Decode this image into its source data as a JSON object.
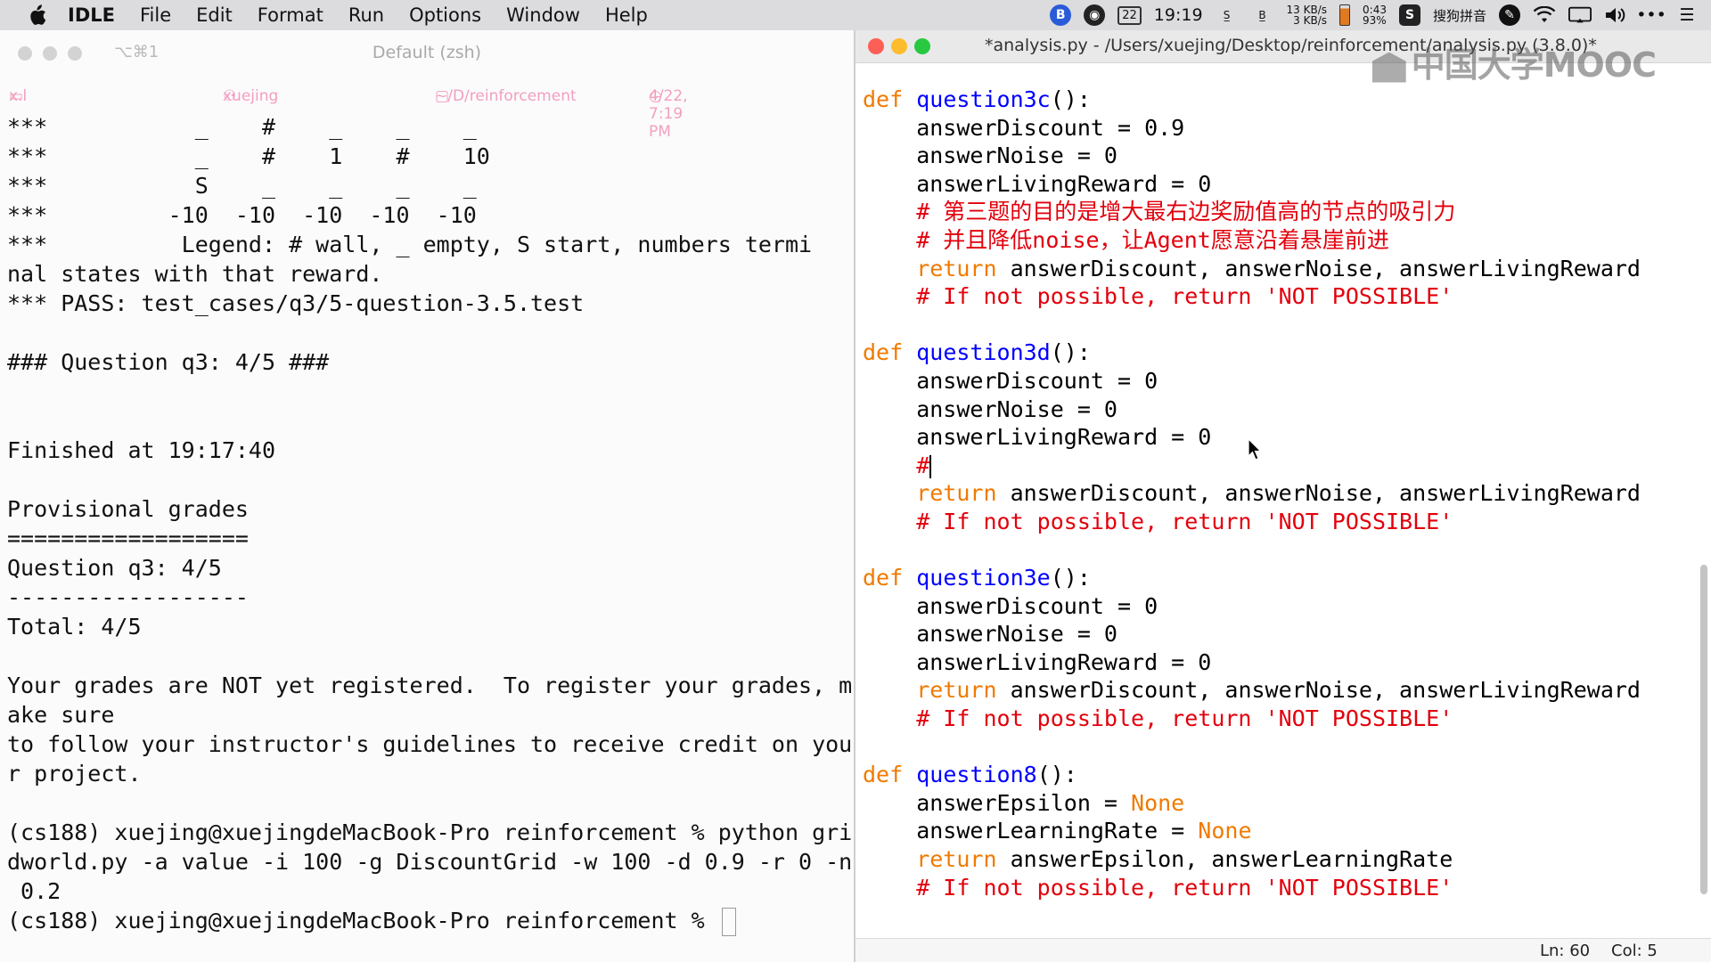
{
  "menubar": {
    "items": [
      "IDLE",
      "File",
      "Edit",
      "Format",
      "Run",
      "Options",
      "Window",
      "Help"
    ],
    "clock": "19:19",
    "calendar_day": "22",
    "net_up": "13 KB/s",
    "net_down": "3 KB/s",
    "battery_time": "0:43",
    "battery_pct": "93%",
    "input_method": "搜狗拼音",
    "icons": [
      "apple-icon",
      "bluetooth-icon",
      "chrome-icon",
      "calendar-icon",
      "s-icon",
      "b-icon",
      "battery-icon",
      "sogou-icon",
      "app-icon",
      "wifi-icon",
      "display-icon",
      "volume-icon",
      "more-icon",
      "list-icon"
    ]
  },
  "terminal": {
    "title": "Default (zsh)",
    "shortcut": "⌥⌘1",
    "tab_label": "x.l",
    "user": "xuejing",
    "folder": "~/D/reinforcement",
    "datetime": "4/22, 7:19 PM",
    "lines": [
      "***           _    #    _    _    _",
      "***           _    #    1    #    10",
      "***           S    _    _    _    _",
      "***         -10  -10  -10  -10  -10",
      "***          Legend: # wall, _ empty, S start, numbers termi",
      "nal states with that reward.",
      "*** PASS: test_cases/q3/5-question-3.5.test",
      "",
      "### Question q3: 4/5 ###",
      "",
      "",
      "Finished at 19:17:40",
      "",
      "Provisional grades",
      "==================",
      "Question q3: 4/5",
      "------------------",
      "Total: 4/5",
      "",
      "Your grades are NOT yet registered.  To register your grades, m",
      "ake sure",
      "to follow your instructor's guidelines to receive credit on you",
      "r project.",
      "",
      "(cs188) xuejing@xuejingdeMacBook-Pro reinforcement % python gri",
      "dworld.py -a value -i 100 -g DiscountGrid -w 100 -d 0.9 -r 0 -n",
      " 0.2",
      "(cs188) xuejing@xuejingdeMacBook-Pro reinforcement % "
    ]
  },
  "editor": {
    "title": "*analysis.py - /Users/xuejing/Desktop/reinforcement/analysis.py (3.8.0)*",
    "watermark": "中国大学MOOC",
    "status_line": "Ln: 60",
    "status_col": "Col: 5",
    "code": [
      [
        [
          "kw",
          "def "
        ],
        [
          "fn",
          "question3c"
        ],
        [
          "",
          "():"
        ]
      ],
      [
        [
          "",
          "    answerDiscount = 0.9"
        ]
      ],
      [
        [
          "",
          "    answerNoise = 0"
        ]
      ],
      [
        [
          "",
          "    answerLivingReward = 0"
        ]
      ],
      [
        [
          "cm",
          "    # 第三题的目的是增大最右边奖励值高的节点的吸引力"
        ]
      ],
      [
        [
          "cm",
          "    # 并且降低noise，让Agent愿意沿着悬崖前进"
        ]
      ],
      [
        [
          "kw",
          "    return"
        ],
        [
          "",
          " answerDiscount, answerNoise, answerLivingReward"
        ]
      ],
      [
        [
          "cm",
          "    # If not possible, return 'NOT POSSIBLE'"
        ]
      ],
      [
        [
          "",
          ""
        ]
      ],
      [
        [
          "kw",
          "def "
        ],
        [
          "fn",
          "question3d"
        ],
        [
          "",
          "():"
        ]
      ],
      [
        [
          "",
          "    answerDiscount = 0"
        ]
      ],
      [
        [
          "",
          "    answerNoise = 0"
        ]
      ],
      [
        [
          "",
          "    answerLivingReward = 0"
        ]
      ],
      [
        [
          "cm",
          "    #"
        ],
        [
          "caret",
          ""
        ]
      ],
      [
        [
          "kw",
          "    return"
        ],
        [
          "",
          " answerDiscount, answerNoise, answerLivingReward"
        ]
      ],
      [
        [
          "cm",
          "    # If not possible, return 'NOT POSSIBLE'"
        ]
      ],
      [
        [
          "",
          ""
        ]
      ],
      [
        [
          "kw",
          "def "
        ],
        [
          "fn",
          "question3e"
        ],
        [
          "",
          "():"
        ]
      ],
      [
        [
          "",
          "    answerDiscount = 0"
        ]
      ],
      [
        [
          "",
          "    answerNoise = 0"
        ]
      ],
      [
        [
          "",
          "    answerLivingReward = 0"
        ]
      ],
      [
        [
          "kw",
          "    return"
        ],
        [
          "",
          " answerDiscount, answerNoise, answerLivingReward"
        ]
      ],
      [
        [
          "cm",
          "    # If not possible, return 'NOT POSSIBLE'"
        ]
      ],
      [
        [
          "",
          ""
        ]
      ],
      [
        [
          "kw",
          "def "
        ],
        [
          "fn",
          "question8"
        ],
        [
          "",
          "():"
        ]
      ],
      [
        [
          "",
          "    answerEpsilon = "
        ],
        [
          "bi",
          "None"
        ]
      ],
      [
        [
          "",
          "    answerLearningRate = "
        ],
        [
          "bi",
          "None"
        ]
      ],
      [
        [
          "kw",
          "    return"
        ],
        [
          "",
          " answerEpsilon, answerLearningRate"
        ]
      ],
      [
        [
          "cm",
          "    # If not possible, return 'NOT POSSIBLE'"
        ]
      ]
    ]
  }
}
